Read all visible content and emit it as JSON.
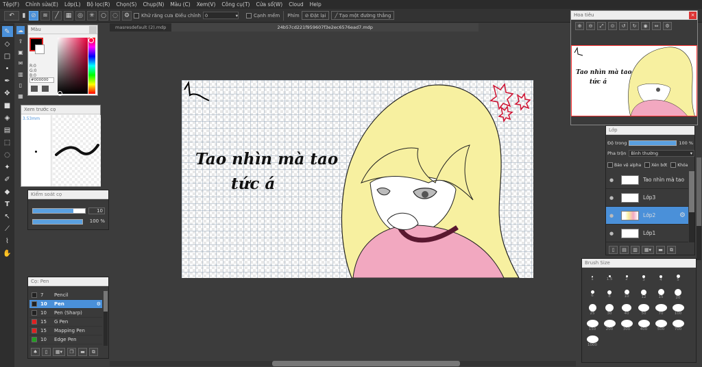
{
  "menu": [
    "Tệp(F)",
    "Chỉnh sửa(E)",
    "Lớp(L)",
    "Bộ lọc(R)",
    "Chọn(S)",
    "Chụp(N)",
    "Màu (C)",
    "Xem(V)",
    "Công cụ(T)",
    "Cửa sổ(W)",
    "Cloud",
    "Help"
  ],
  "toolbar": {
    "antialias_label": "Khử răng cưa",
    "adjust_label": "Điều chỉnh",
    "adjust_value": "0",
    "sharp_label": "Cạnh mềm",
    "keys_label": "Phím",
    "reset_label": "Đặt lại",
    "line_label": "Tạo một đường thẳng"
  },
  "doc_tabs": [
    "masresdefault (2).mdp",
    "24b57cd221f959607f3e2ec6576ead7.mdp"
  ],
  "color_panel": {
    "title": "Màu",
    "r": "R:0",
    "g": "G:0",
    "b": "B:0",
    "hex": "#000000"
  },
  "preview_panel": {
    "title": "Xem trước cọ",
    "size": "3.53mm"
  },
  "brush_control": {
    "title": "Kiểm soát cọ",
    "size_value": "10",
    "size_fill": 0.78,
    "opacity_value": "100 %",
    "opacity_fill": 1.0
  },
  "pen_panel": {
    "title": "Cọ: Pen",
    "items": [
      {
        "size": "7",
        "name": "Pencil",
        "color": "#222222"
      },
      {
        "size": "10",
        "name": "Pen",
        "color": "#222222",
        "selected": true
      },
      {
        "size": "10",
        "name": "Pen (Sharp)",
        "color": "#222222"
      },
      {
        "size": "15",
        "name": "G Pen",
        "color": "#e02020"
      },
      {
        "size": "15",
        "name": "Mapping Pen",
        "color": "#e02020"
      },
      {
        "size": "10",
        "name": "Edge Pen",
        "color": "#20a020"
      }
    ]
  },
  "canvas_text": {
    "line1": "Tao nhìn mà tao",
    "line2": "tức á"
  },
  "navigator": {
    "title": "Hoa tiêu",
    "line1": "Tao nhìn mà tao",
    "line2": "tức á"
  },
  "layer_panel": {
    "title": "Lớp",
    "opacity_label": "Độ trong",
    "opacity_value": "100 %",
    "opacity_fill": 1.0,
    "blend_label": "Pha trộn",
    "blend_value": "Bình thường",
    "protect_alpha": "Bảo vệ alpha",
    "clipping": "Xén bớt",
    "lock": "Khóa",
    "layers": [
      {
        "name": "Tao nhìn mà tao",
        "selected": false
      },
      {
        "name": "Lớp3",
        "selected": false
      },
      {
        "name": "Lớp2",
        "selected": true
      },
      {
        "name": "Lớp1",
        "selected": false
      }
    ]
  },
  "brush_size": {
    "title": "Brush Size",
    "sizes": [
      "1",
      "1.5",
      "2",
      "3",
      "4",
      "5",
      "6",
      "8",
      "10",
      "12",
      "15",
      "20",
      "25",
      "30",
      "40",
      "50",
      "70",
      "100",
      "150",
      "200",
      "300",
      "400",
      "500",
      "700",
      "1000"
    ]
  },
  "colors": {
    "accent": "#4a90d9",
    "primary_color": "#000000"
  }
}
